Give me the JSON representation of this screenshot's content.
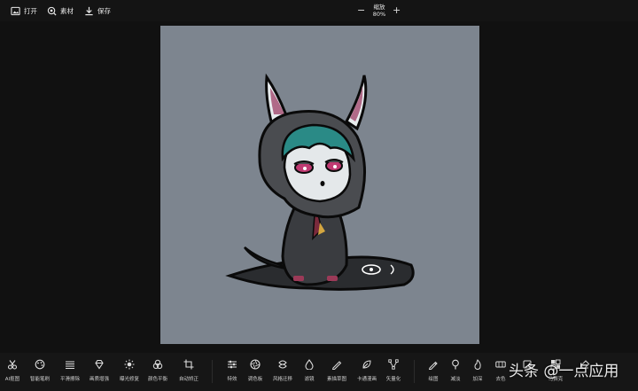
{
  "toolbar": {
    "open_label": "打开",
    "assets_label": "素材",
    "save_label": "保存",
    "zoom_label": "缩放",
    "zoom_value": "80%",
    "zoom_minus": "−",
    "zoom_plus": "+"
  },
  "tools_left": [
    {
      "label": "AI抠图",
      "icon": "scissors-icon"
    },
    {
      "label": "智能笔刷",
      "icon": "palette-icon"
    },
    {
      "label": "平滑擦除",
      "icon": "waves-icon"
    },
    {
      "label": "画质增强",
      "icon": "diamond-icon"
    },
    {
      "label": "曝光修复",
      "icon": "sun-icon"
    },
    {
      "label": "颜色平衡",
      "icon": "color-circles-icon"
    },
    {
      "label": "自动矫正",
      "icon": "crop-icon"
    }
  ],
  "tools_middle": [
    {
      "label": "特效",
      "icon": "sliders-icon"
    },
    {
      "label": "调色板",
      "icon": "aperture-icon"
    },
    {
      "label": "风格迁移",
      "icon": "style-icon"
    },
    {
      "label": "滤镜",
      "icon": "drop-icon"
    },
    {
      "label": "素描草图",
      "icon": "pencil-ruler-icon"
    },
    {
      "label": "卡通漫画",
      "icon": "leaf-icon"
    },
    {
      "label": "矢量化",
      "icon": "vector-icon"
    }
  ],
  "tools_right": [
    {
      "label": "绘图",
      "icon": "pen-icon"
    },
    {
      "label": "减淡",
      "icon": "magnifier-icon"
    },
    {
      "label": "加深",
      "icon": "flame-icon"
    },
    {
      "label": "去色",
      "icon": "grid-icon"
    },
    {
      "label": "",
      "icon": "blank-icon"
    },
    {
      "label": "马赛克",
      "icon": "mosaic-icon"
    },
    {
      "label": "",
      "icon": "eraser-icon"
    }
  ],
  "watermark": "头条 @一点应用"
}
